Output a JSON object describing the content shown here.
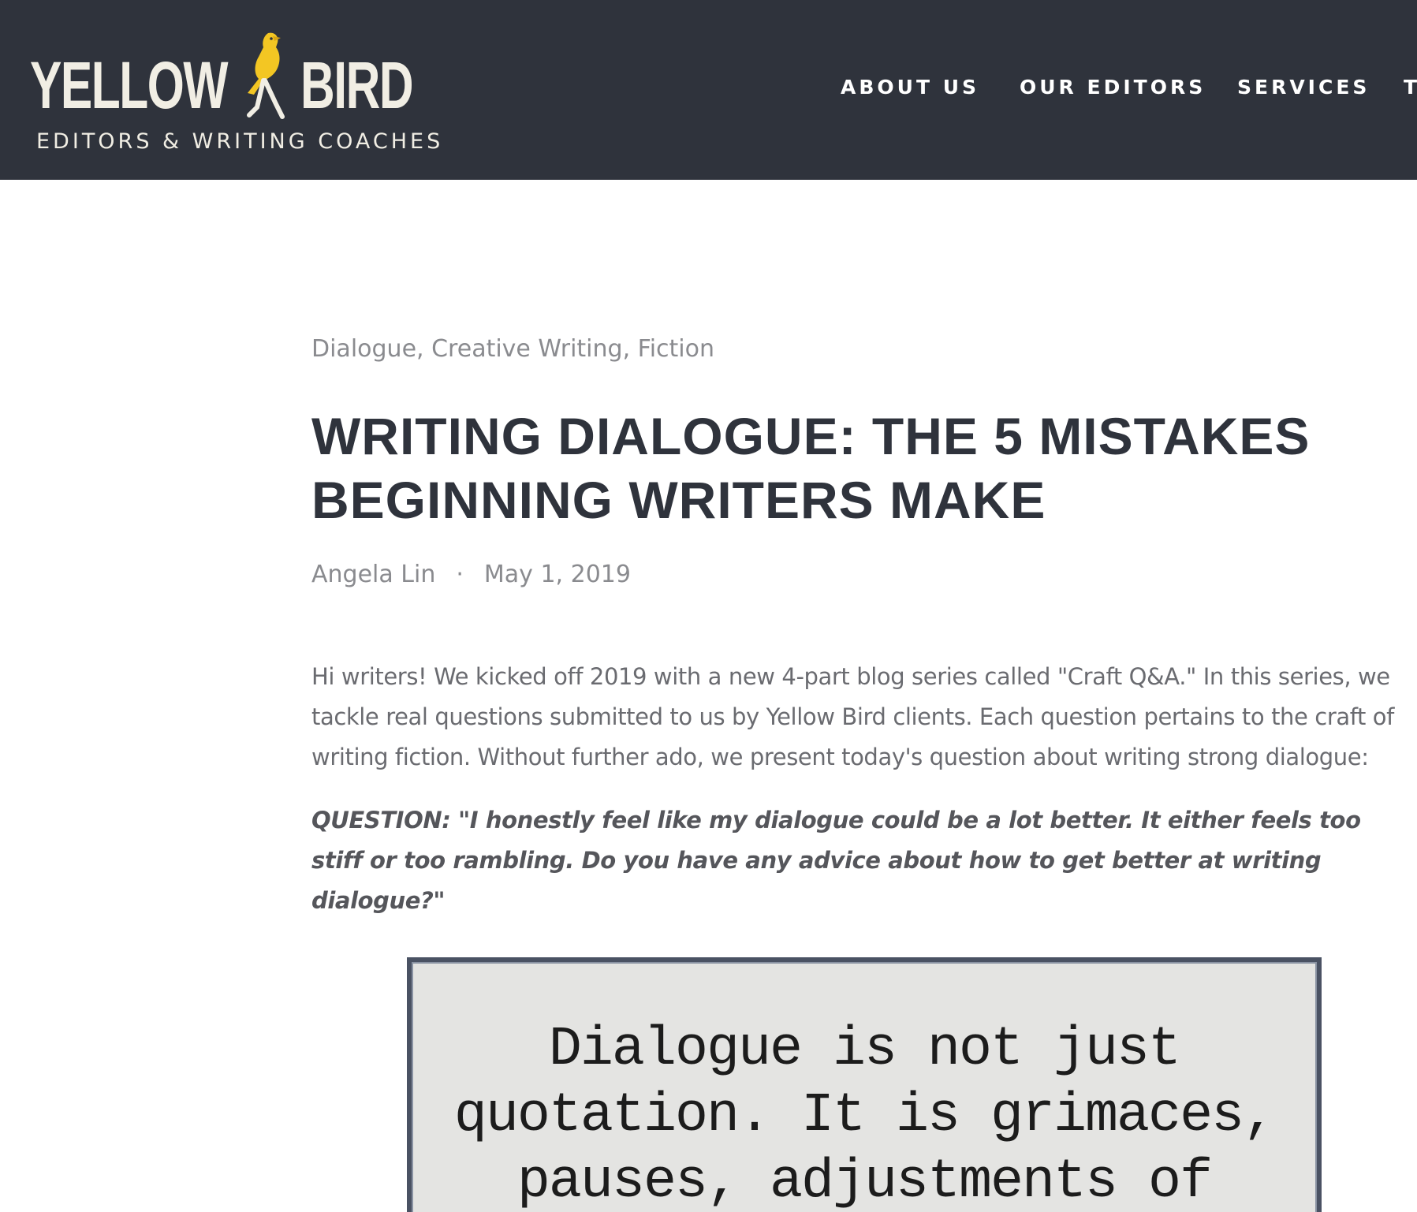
{
  "header": {
    "logo": {
      "word_1": "YELLOW",
      "word_2": "BIRD",
      "tagline": "EDITORS & WRITING COACHES"
    },
    "nav": {
      "about": "ABOUT US",
      "editors": "OUR EDITORS",
      "services": "SERVICES",
      "truncated": "T"
    },
    "colors": {
      "background": "#2f333c",
      "logo_text": "#f1eee4",
      "bird": "#f3c623"
    }
  },
  "article": {
    "categories": {
      "c1": "Dialogue",
      "c2": "Creative Writing",
      "c3": "Fiction",
      "separator": ", "
    },
    "title": "WRITING DIALOGUE: THE 5 MISTAKES BEGINNING WRITERS MAKE",
    "author": "Angela Lin",
    "meta_separator": "·",
    "date": "May 1, 2019",
    "intro": "Hi writers! We kicked off 2019 with a new 4-part blog series called \"Craft Q&A.\" In this series, we tackle real questions submitted to us by Yellow Bird clients. Each question pertains to the craft of writing fiction. Without further ado, we present today's question about writing strong dialogue:",
    "question": "QUESTION: \"I honestly feel like my dialogue could be a lot better. It either feels too stiff or too rambling. Do you have any advice about how to get better at writing dialogue?\""
  },
  "quote_image": {
    "line_1": "Dialogue is not just",
    "line_2": "quotation. It is grimaces,",
    "line_3": "pauses, adjustments of"
  }
}
